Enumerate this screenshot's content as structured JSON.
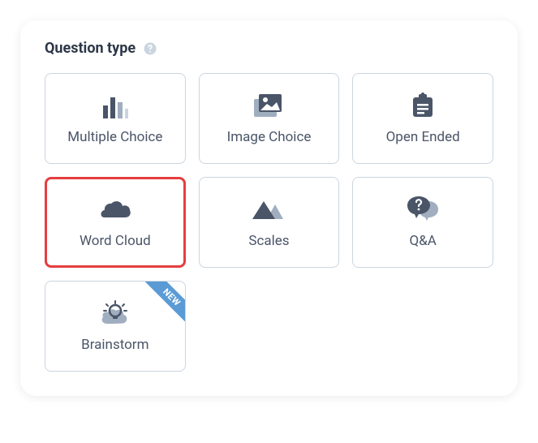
{
  "header": {
    "title": "Question type"
  },
  "cards": [
    {
      "label": "Multiple Choice",
      "icon": "bar-chart-icon",
      "selected": false,
      "badge": null
    },
    {
      "label": "Image Choice",
      "icon": "image-icon",
      "selected": false,
      "badge": null
    },
    {
      "label": "Open Ended",
      "icon": "clipboard-icon",
      "selected": false,
      "badge": null
    },
    {
      "label": "Word Cloud",
      "icon": "cloud-icon",
      "selected": true,
      "badge": null
    },
    {
      "label": "Scales",
      "icon": "mountain-icon",
      "selected": false,
      "badge": null
    },
    {
      "label": "Q&A",
      "icon": "question-bubble-icon",
      "selected": false,
      "badge": null
    },
    {
      "label": "Brainstorm",
      "icon": "lightbulb-icon",
      "selected": false,
      "badge": "NEW"
    }
  ],
  "colors": {
    "icon_dark": "#4a5568",
    "icon_light": "#a0aec0",
    "selected_border": "#e53e3e",
    "badge_bg": "#5b9bd5"
  }
}
